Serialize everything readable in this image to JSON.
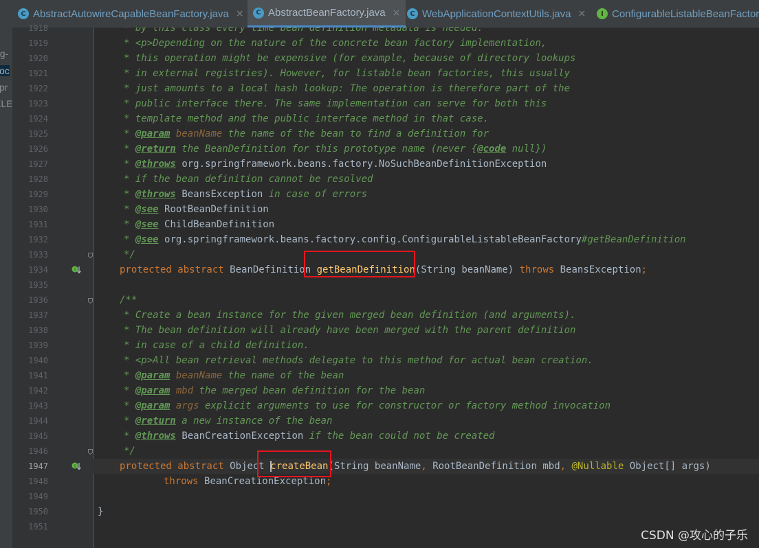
{
  "tabs": [
    {
      "label": "AbstractAutowireCapableBeanFactory.java",
      "icon": "class-icon",
      "active": false,
      "closable": true
    },
    {
      "label": "AbstractBeanFactory.java",
      "icon": "class-icon",
      "active": true,
      "closable": true
    },
    {
      "label": "WebApplicationContextUtils.java",
      "icon": "class-icon",
      "active": false,
      "closable": true
    },
    {
      "label": "ConfigurableListableBeanFactor",
      "icon": "interface-icon",
      "active": false,
      "closable": false
    }
  ],
  "project_panel_fragments": [
    "ng-",
    "coc",
    "spr",
    "ELE"
  ],
  "current_line": "1947",
  "lines": [
    {
      "n": "1918",
      "segs": [
        [
          "c",
          "* by this class every time bean definition metadata is needed."
        ]
      ]
    },
    {
      "n": "1919",
      "segs": [
        [
          "c",
          "* <p>Depending on the nature of the concrete bean factory implementation,"
        ]
      ]
    },
    {
      "n": "1920",
      "segs": [
        [
          "c",
          "* this operation might be expensive (for example, because of directory lookups"
        ]
      ]
    },
    {
      "n": "1921",
      "segs": [
        [
          "c",
          "* in external registries). However, for listable bean factories, this usually"
        ]
      ]
    },
    {
      "n": "1922",
      "segs": [
        [
          "c",
          "* just amounts to a local hash lookup: The operation is therefore part of the"
        ]
      ]
    },
    {
      "n": "1923",
      "segs": [
        [
          "c",
          "* public interface there. The same implementation can serve for both this"
        ]
      ]
    },
    {
      "n": "1924",
      "segs": [
        [
          "c",
          "* template method and the public interface method in that case."
        ]
      ]
    },
    {
      "n": "1925",
      "segs": [
        [
          "c",
          "* "
        ],
        [
          "t",
          "@param"
        ],
        [
          "c",
          " "
        ],
        [
          "p",
          "beanName"
        ],
        [
          "c",
          " the name of the bean to find a definition for"
        ]
      ]
    },
    {
      "n": "1926",
      "segs": [
        [
          "c",
          "* "
        ],
        [
          "t",
          "@return"
        ],
        [
          "c",
          " the BeanDefinition for this prototype name (never {"
        ],
        [
          "t",
          "@code"
        ],
        [
          "c",
          " null})"
        ]
      ]
    },
    {
      "n": "1927",
      "segs": [
        [
          "c",
          "* "
        ],
        [
          "t",
          "@throws"
        ],
        [
          "c",
          " "
        ],
        [
          "r",
          "org.springframework.beans.factory.NoSuchBeanDefinitionException"
        ]
      ]
    },
    {
      "n": "1928",
      "segs": [
        [
          "c",
          "* if the bean definition cannot be resolved"
        ]
      ]
    },
    {
      "n": "1929",
      "segs": [
        [
          "c",
          "* "
        ],
        [
          "t",
          "@throws"
        ],
        [
          "c",
          " "
        ],
        [
          "r",
          "BeansException"
        ],
        [
          "c",
          " in case of errors"
        ]
      ]
    },
    {
      "n": "1930",
      "segs": [
        [
          "c",
          "* "
        ],
        [
          "t",
          "@see"
        ],
        [
          "c",
          " "
        ],
        [
          "r",
          "RootBeanDefinition"
        ]
      ]
    },
    {
      "n": "1931",
      "segs": [
        [
          "c",
          "* "
        ],
        [
          "t",
          "@see"
        ],
        [
          "c",
          " "
        ],
        [
          "r",
          "ChildBeanDefinition"
        ]
      ]
    },
    {
      "n": "1932",
      "segs": [
        [
          "c",
          "* "
        ],
        [
          "t",
          "@see"
        ],
        [
          "c",
          " "
        ],
        [
          "r",
          "org.springframework.beans.factory.config.ConfigurableListableBeanFactory"
        ],
        [
          "c",
          "#getBeanDefinition"
        ]
      ]
    },
    {
      "n": "1933",
      "segs": [
        [
          "c",
          "*/"
        ]
      ]
    },
    {
      "n": "1934",
      "segs": [
        [
          "k",
          "protected abstract "
        ],
        [
          "r",
          "BeanDefinition "
        ],
        [
          "f",
          "getBeanDefinition"
        ],
        [
          "r",
          "(String beanName) "
        ],
        [
          "k",
          "throws "
        ],
        [
          "r",
          "BeansException"
        ],
        [
          "k",
          ";"
        ]
      ]
    },
    {
      "n": "1935",
      "segs": []
    },
    {
      "n": "1936",
      "segs": [
        [
          "c",
          "/**"
        ]
      ]
    },
    {
      "n": "1937",
      "segs": [
        [
          "c",
          "* Create a bean instance for the given merged bean definition (and arguments)."
        ]
      ]
    },
    {
      "n": "1938",
      "segs": [
        [
          "c",
          "* The bean definition will already have been merged with the parent definition"
        ]
      ]
    },
    {
      "n": "1939",
      "segs": [
        [
          "c",
          "* in case of a child definition."
        ]
      ]
    },
    {
      "n": "1940",
      "segs": [
        [
          "c",
          "* <p>All bean retrieval methods delegate to this method for actual bean creation."
        ]
      ]
    },
    {
      "n": "1941",
      "segs": [
        [
          "c",
          "* "
        ],
        [
          "t",
          "@param"
        ],
        [
          "c",
          " "
        ],
        [
          "p",
          "beanName"
        ],
        [
          "c",
          " the name of the bean"
        ]
      ]
    },
    {
      "n": "1942",
      "segs": [
        [
          "c",
          "* "
        ],
        [
          "t",
          "@param"
        ],
        [
          "c",
          " "
        ],
        [
          "p",
          "mbd"
        ],
        [
          "c",
          " the merged bean definition for the bean"
        ]
      ]
    },
    {
      "n": "1943",
      "segs": [
        [
          "c",
          "* "
        ],
        [
          "t",
          "@param"
        ],
        [
          "c",
          " "
        ],
        [
          "p",
          "args"
        ],
        [
          "c",
          " explicit arguments to use for constructor or factory method invocation"
        ]
      ]
    },
    {
      "n": "1944",
      "segs": [
        [
          "c",
          "* "
        ],
        [
          "t",
          "@return"
        ],
        [
          "c",
          " a new instance of the bean"
        ]
      ]
    },
    {
      "n": "1945",
      "segs": [
        [
          "c",
          "* "
        ],
        [
          "t",
          "@throws"
        ],
        [
          "c",
          " "
        ],
        [
          "r",
          "BeanCreationException"
        ],
        [
          "c",
          " if the bean could not be created"
        ]
      ]
    },
    {
      "n": "1946",
      "segs": [
        [
          "c",
          "*/"
        ]
      ]
    },
    {
      "n": "1947",
      "segs": [
        [
          "k",
          "protected abstract "
        ],
        [
          "r",
          "Object "
        ],
        [
          "f",
          "createBean"
        ],
        [
          "r",
          "(String beanName"
        ],
        [
          "k",
          ", "
        ],
        [
          "r",
          "RootBeanDefinition mbd"
        ],
        [
          "k",
          ", "
        ],
        [
          "a",
          "@Nullable "
        ],
        [
          "r",
          "Object[] args)"
        ]
      ]
    },
    {
      "n": "1948",
      "segs": [
        [
          "k",
          "throws "
        ],
        [
          "r",
          "BeanCreationException"
        ],
        [
          "k",
          ";"
        ]
      ]
    },
    {
      "n": "1949",
      "segs": []
    },
    {
      "n": "1950",
      "segs": [
        [
          "r",
          "}"
        ]
      ]
    },
    {
      "n": "1951",
      "segs": []
    }
  ],
  "watermark": "CSDN @攻心的子乐",
  "colors": {
    "keyword": "#cc7832",
    "method": "#ffc66d",
    "comment": "#629755",
    "annotation": "#bbb529",
    "highlight_box": "#e8141f"
  }
}
